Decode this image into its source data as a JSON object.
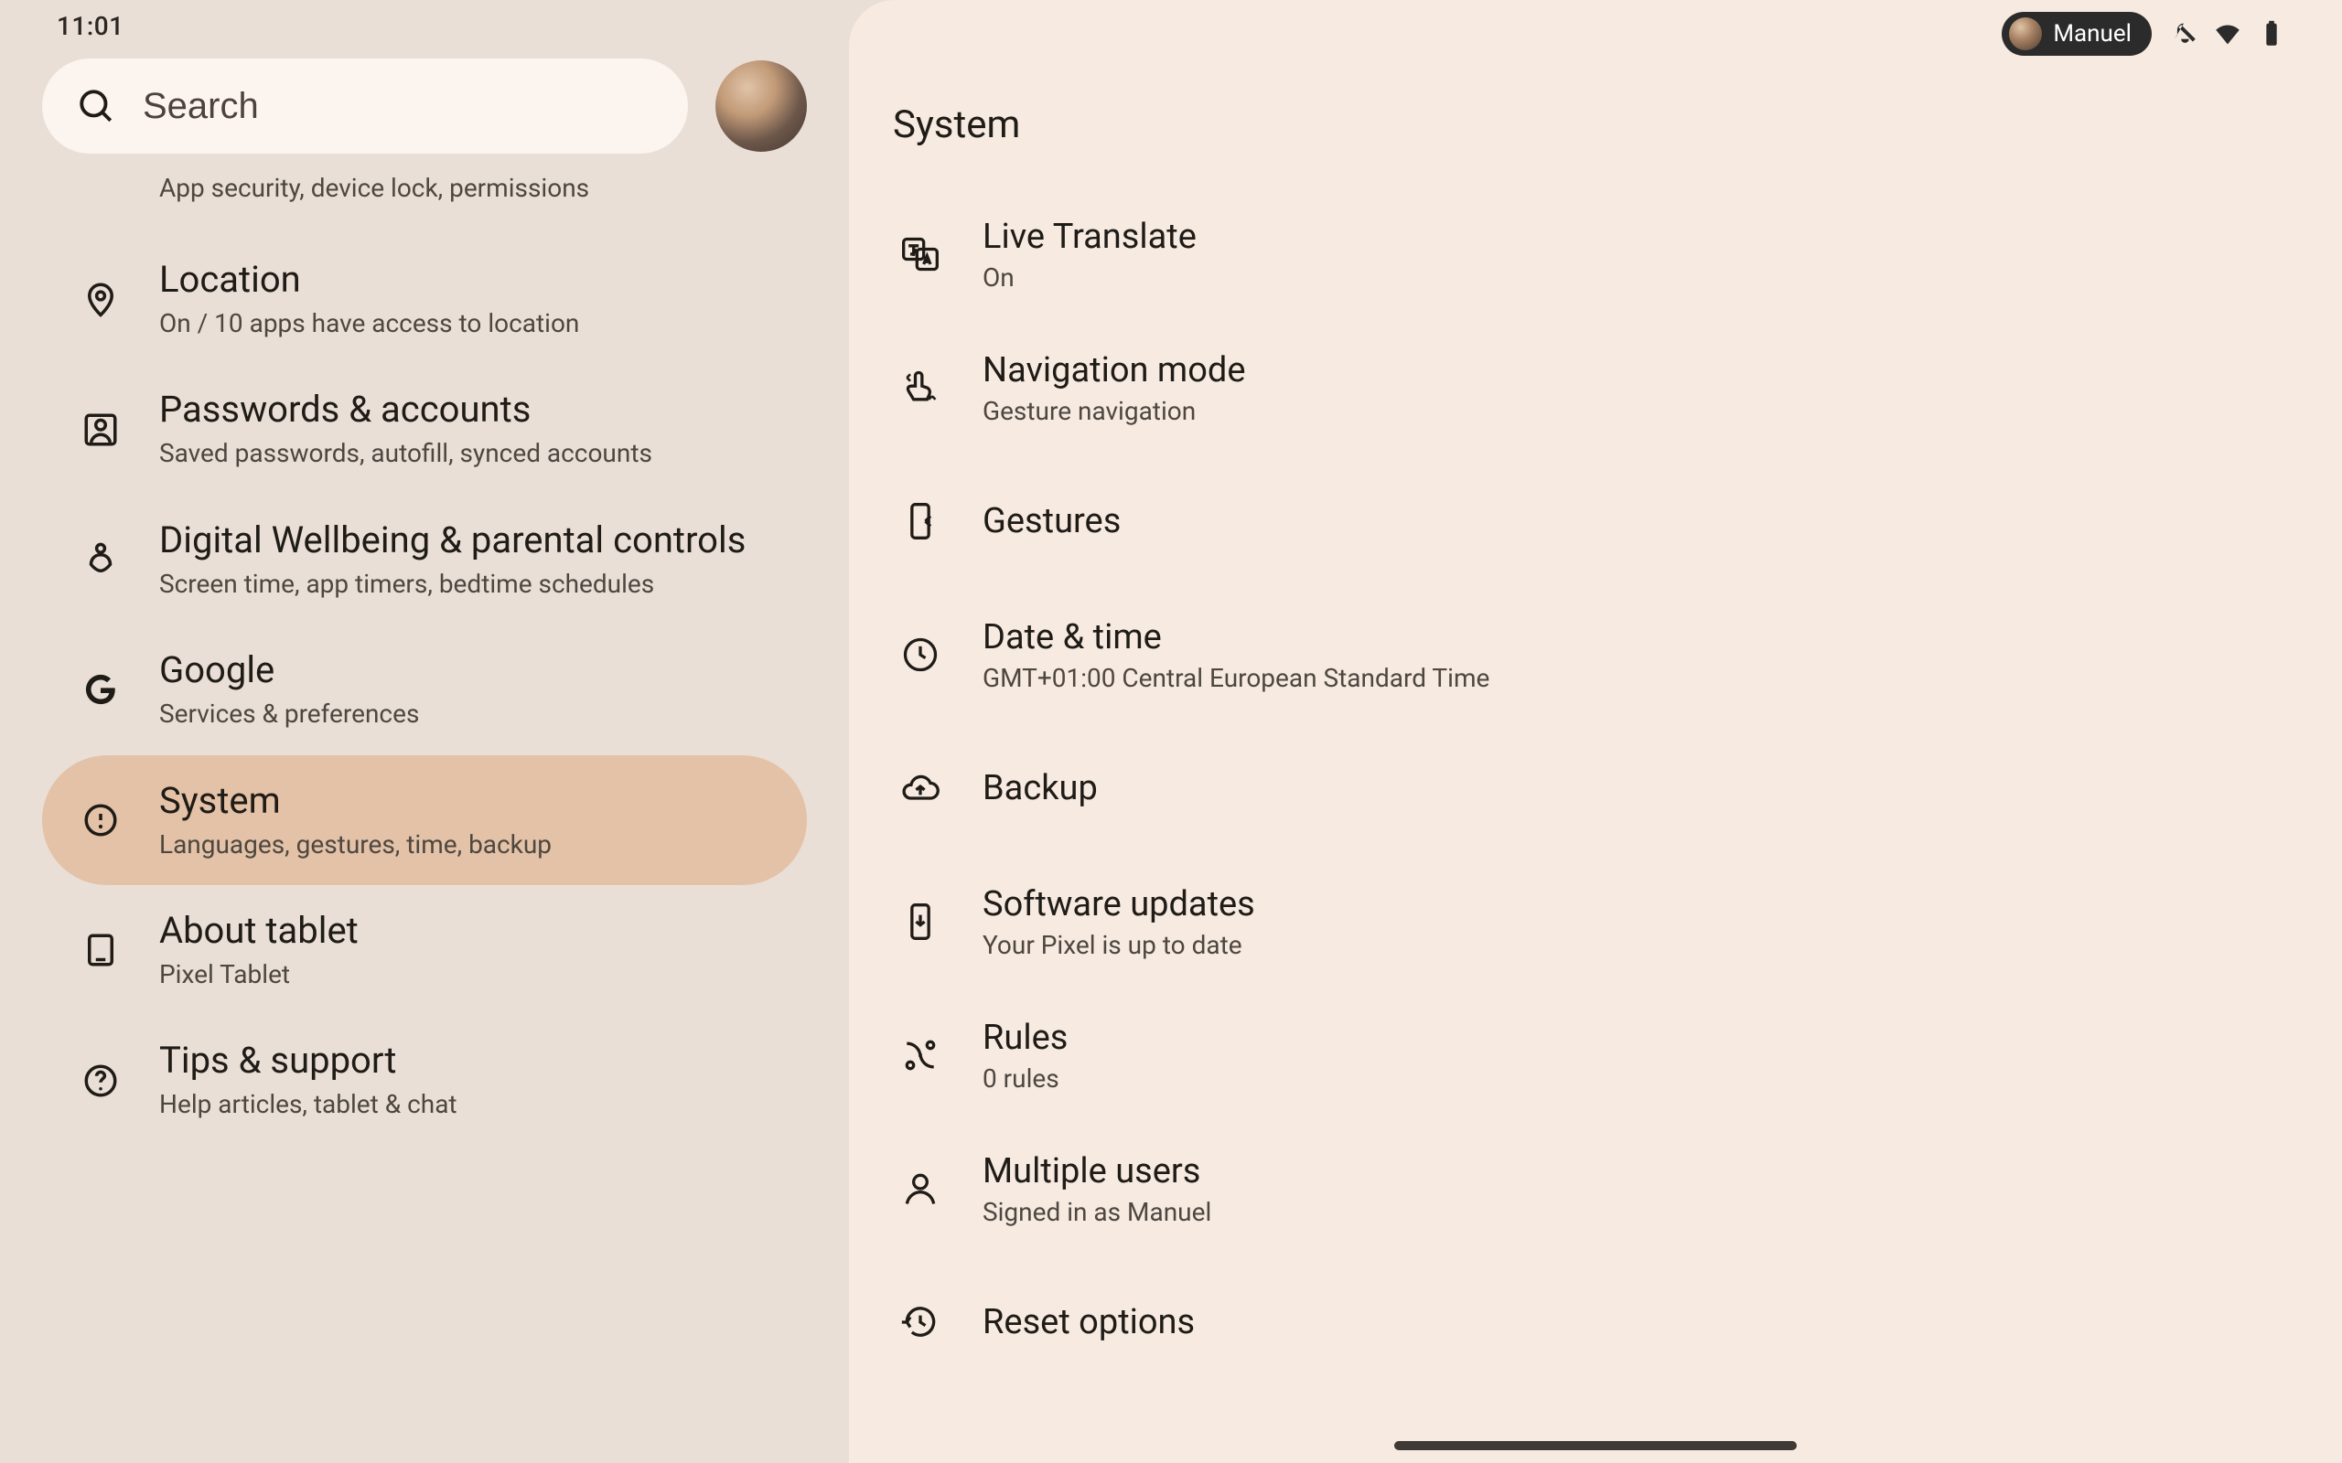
{
  "status": {
    "time": "11:01",
    "user": "Manuel"
  },
  "search": {
    "placeholder": "Search"
  },
  "sidebar": {
    "items": [
      {
        "id": "security-partial",
        "title": "",
        "subtitle": "App security, device lock, permissions"
      },
      {
        "id": "location",
        "title": "Location",
        "subtitle": "On / 10 apps have access to location"
      },
      {
        "id": "passwords",
        "title": "Passwords & accounts",
        "subtitle": "Saved passwords, autofill, synced accounts"
      },
      {
        "id": "wellbeing",
        "title": "Digital Wellbeing & parental controls",
        "subtitle": "Screen time, app timers, bedtime schedules"
      },
      {
        "id": "google",
        "title": "Google",
        "subtitle": "Services & preferences"
      },
      {
        "id": "system",
        "title": "System",
        "subtitle": "Languages, gestures, time, backup"
      },
      {
        "id": "about",
        "title": "About tablet",
        "subtitle": "Pixel Tablet"
      },
      {
        "id": "tips",
        "title": "Tips & support",
        "subtitle": "Help articles, tablet & chat"
      }
    ],
    "selected": "system"
  },
  "detail": {
    "header": "System",
    "items": [
      {
        "id": "live-translate",
        "title": "Live Translate",
        "subtitle": "On"
      },
      {
        "id": "navigation-mode",
        "title": "Navigation mode",
        "subtitle": "Gesture navigation"
      },
      {
        "id": "gestures",
        "title": "Gestures",
        "subtitle": ""
      },
      {
        "id": "date-time",
        "title": "Date & time",
        "subtitle": "GMT+01:00 Central European Standard Time"
      },
      {
        "id": "backup",
        "title": "Backup",
        "subtitle": ""
      },
      {
        "id": "software",
        "title": "Software updates",
        "subtitle": "Your Pixel is up to date"
      },
      {
        "id": "rules",
        "title": "Rules",
        "subtitle": "0 rules"
      },
      {
        "id": "multiple-users",
        "title": "Multiple users",
        "subtitle": "Signed in as Manuel"
      },
      {
        "id": "reset",
        "title": "Reset options",
        "subtitle": ""
      }
    ]
  }
}
